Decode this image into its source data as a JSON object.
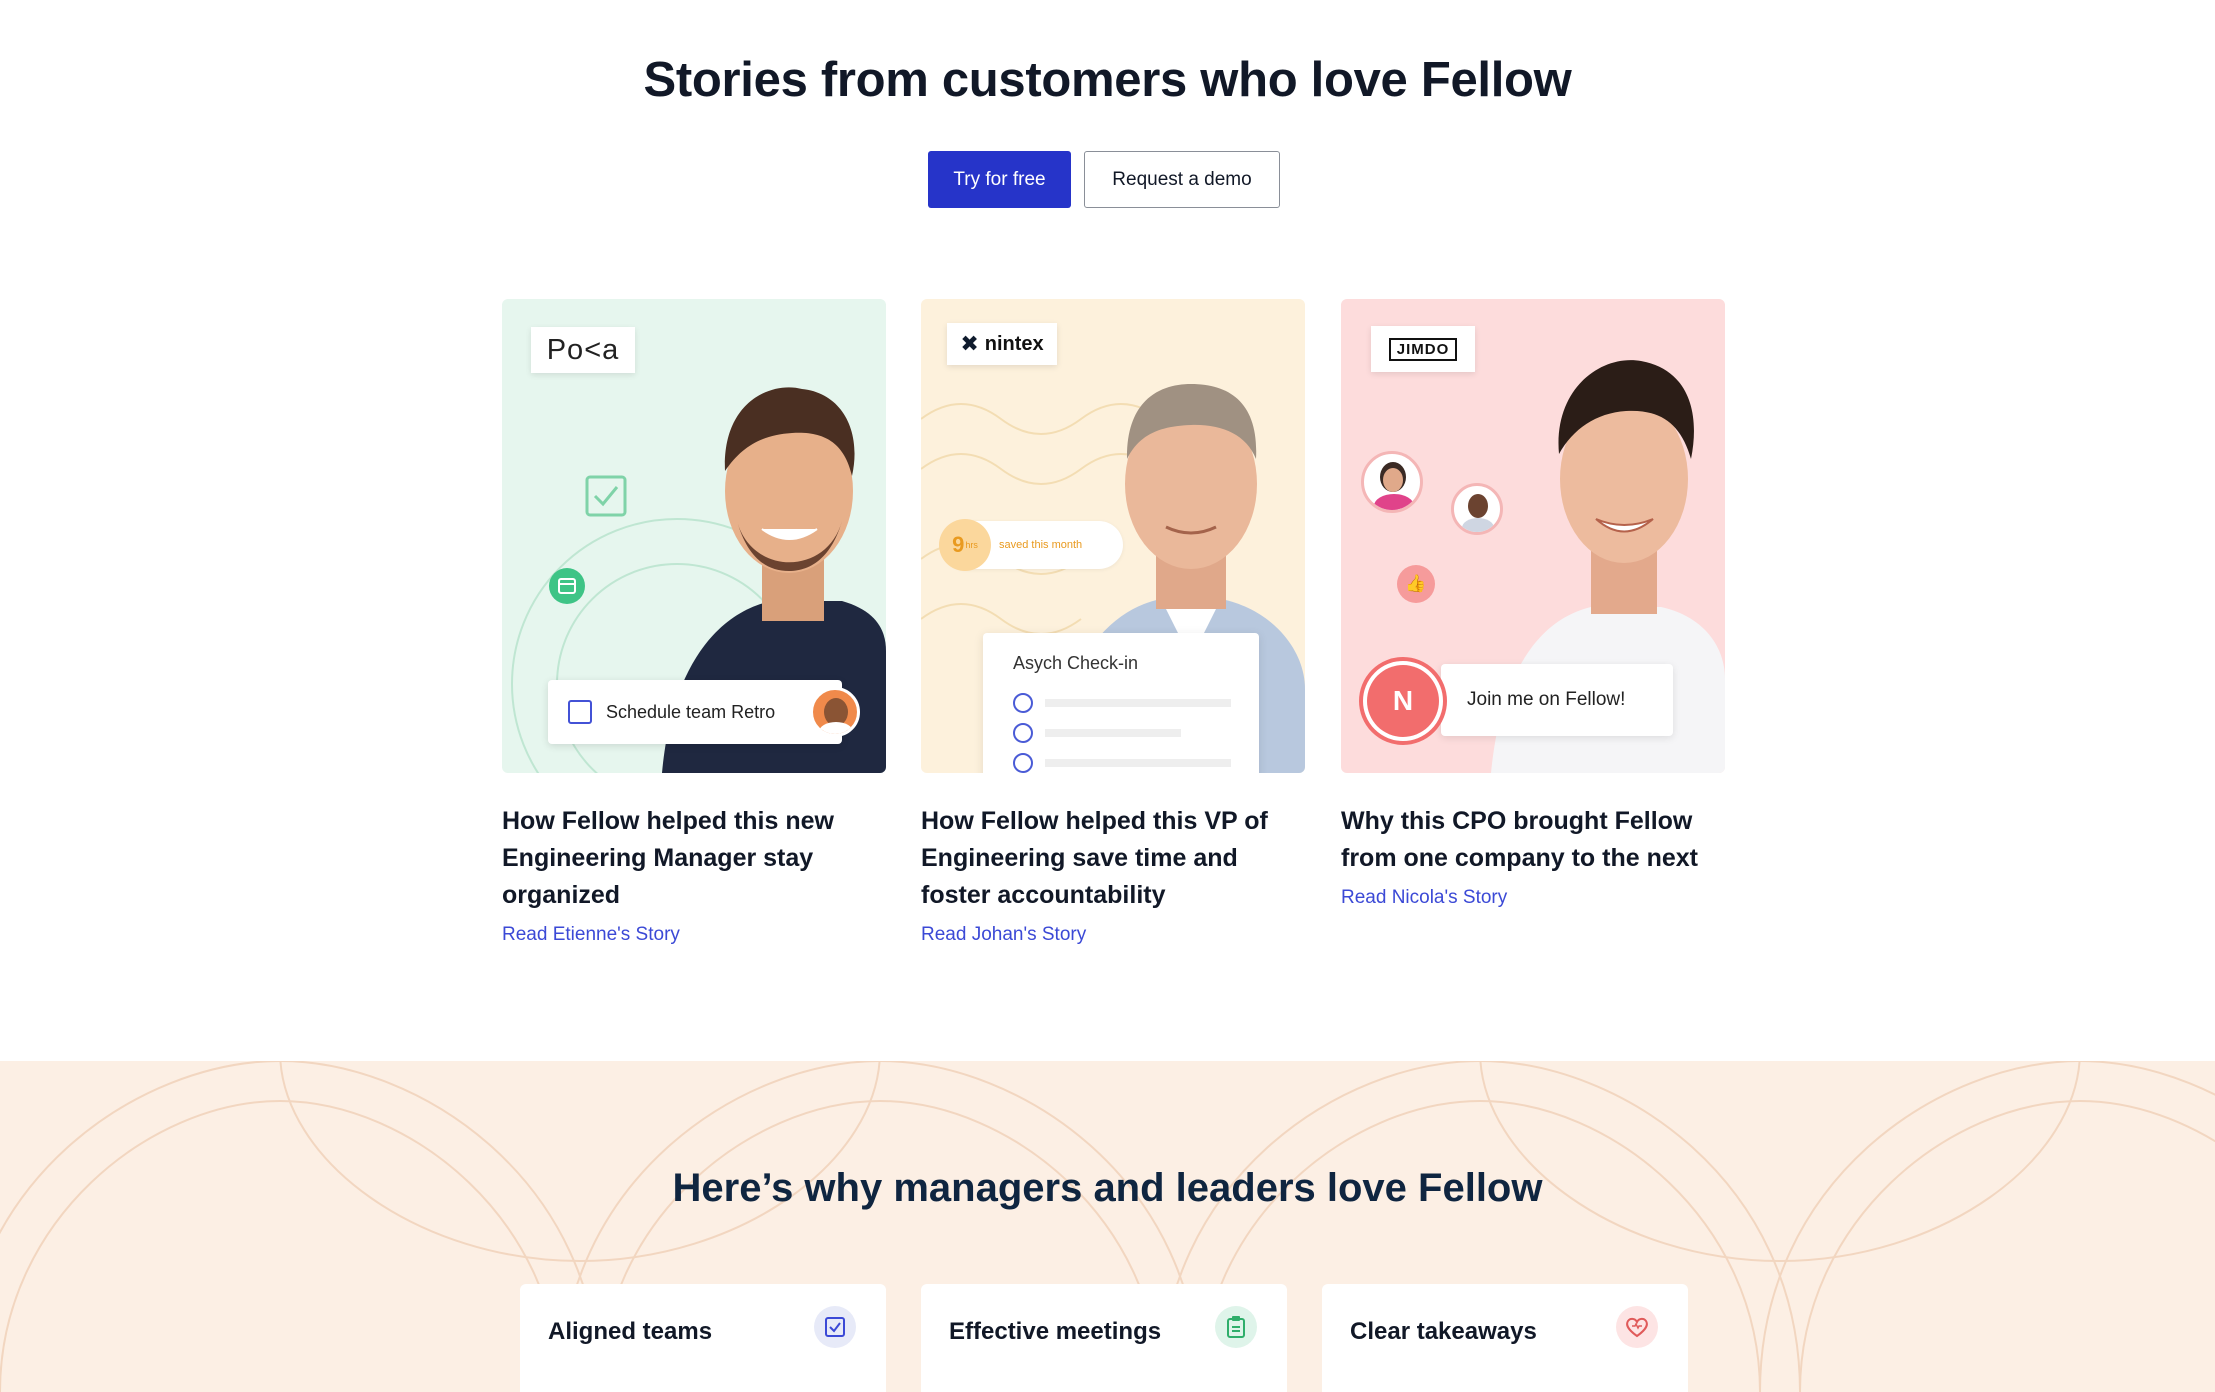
{
  "stories": {
    "title": "Stories from customers who love Fellow",
    "try_free_label": "Try for free",
    "request_demo_label": "Request a demo"
  },
  "cards": [
    {
      "logo": "Po<a",
      "title": "How Fellow helped this new Engineering Manager stay organized",
      "link": "Read Etienne's Story",
      "overlay_label": "Schedule team Retro",
      "bg": "#e6f6ee"
    },
    {
      "logo": "nintex",
      "title": "How Fellow helped this VP of Engineering save time and foster accountability",
      "link": "Read Johan's Story",
      "overlay_label": "Asych Check-in",
      "stat_number": "9",
      "stat_unit": "hrs",
      "stat_text": "saved this month",
      "bg": "#fdf1dc"
    },
    {
      "logo": "JIMDO",
      "title": "Why this CPO brought Fellow from one company to the next",
      "link": "Read Nicola's Story",
      "overlay_label": "Join me on Fellow!",
      "avatar_letter": "N",
      "bg": "#fddcdc"
    }
  ],
  "why": {
    "title": "Here’s why managers and leaders love Fellow",
    "features": [
      {
        "label": "Aligned teams",
        "icon": "checkbox-icon",
        "icon_bg": "#e7eaf8",
        "icon_color": "#3b49d6"
      },
      {
        "label": "Effective meetings",
        "icon": "clipboard-icon",
        "icon_bg": "#dff4ea",
        "icon_color": "#2fae6b"
      },
      {
        "label": "Clear takeaways",
        "icon": "heart-icon",
        "icon_bg": "#fde4e4",
        "icon_color": "#e05a5a"
      }
    ]
  }
}
